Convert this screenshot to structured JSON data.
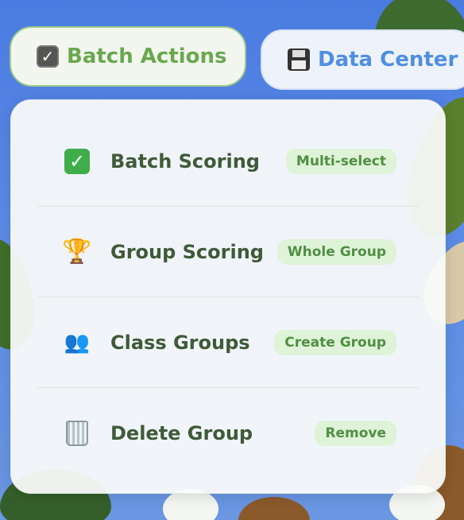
{
  "tabs": {
    "batch_actions": {
      "icon": "checkbox-icon",
      "label": "Batch Actions",
      "color": "#6aa84f"
    },
    "data_center": {
      "icon": "floppy-disk-icon",
      "label": "Data Center",
      "color": "#4e8fe0"
    }
  },
  "menu": {
    "items": [
      {
        "icon": "green-check-icon",
        "label": "Batch Scoring",
        "badge": "Multi-select"
      },
      {
        "icon": "trophy-icon",
        "label": "Group Scoring",
        "badge": "Whole Group"
      },
      {
        "icon": "people-icon",
        "label": "Class Groups",
        "badge": "Create Group"
      },
      {
        "icon": "trash-icon",
        "label": "Delete Group",
        "badge": "Remove"
      }
    ]
  },
  "colors": {
    "badge_bg": "#dff3d8",
    "badge_text": "#4f8f43",
    "label_text": "#3f5a38"
  }
}
